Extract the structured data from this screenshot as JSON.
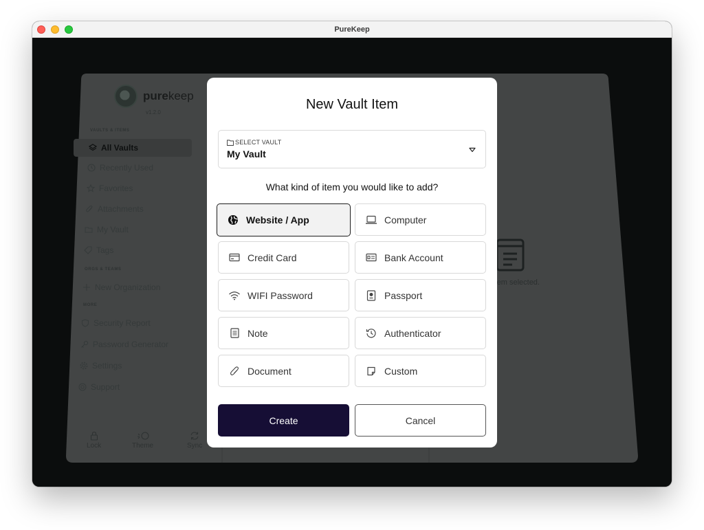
{
  "window": {
    "title": "PureKeep"
  },
  "sidebar": {
    "logo": {
      "bold": "pure",
      "light": "keep"
    },
    "version": "v1.2.0",
    "sections": {
      "vaults_items": "VAULTS & ITEMS",
      "orgs_teams": "ORGS & TEAMS",
      "more": "MORE"
    },
    "items": {
      "all_vaults": "All Vaults",
      "recently_used": "Recently Used",
      "favorites": "Favorites",
      "attachments": "Attachments",
      "my_vault": "My Vault",
      "tags": "Tags",
      "new_organization": "New Organization",
      "security_report": "Security Report",
      "password_generator": "Password Generator",
      "settings": "Settings",
      "support": "Support"
    },
    "bottom": {
      "lock": "Lock",
      "theme": "Theme",
      "sync": "Sync"
    }
  },
  "detail": {
    "empty_text": "No item selected."
  },
  "dialog": {
    "title": "New Vault Item",
    "vault_select": {
      "label": "SELECT VAULT",
      "value": "My Vault"
    },
    "question": "What kind of item you would like to add?",
    "types": {
      "website": "Website / App",
      "computer": "Computer",
      "credit_card": "Credit Card",
      "bank_account": "Bank Account",
      "wifi": "WIFI Password",
      "passport": "Passport",
      "note": "Note",
      "authenticator": "Authenticator",
      "document": "Document",
      "custom": "Custom"
    },
    "selected_type": "Website / App",
    "create": "Create",
    "cancel": "Cancel"
  },
  "colors": {
    "primary_button": "#160e35",
    "backdrop": "#0b0d0d"
  }
}
